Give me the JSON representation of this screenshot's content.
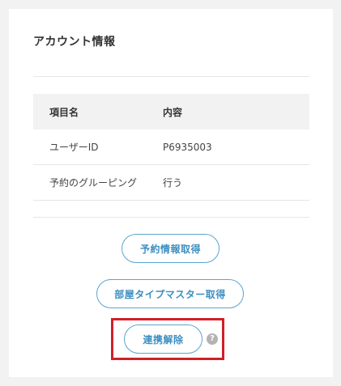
{
  "account_card": {
    "title": "アカウント情報",
    "table": {
      "headers": {
        "name": "項目名",
        "value": "内容"
      },
      "rows": [
        {
          "name": "ユーザーID",
          "value": "P6935003"
        },
        {
          "name": "予約のグルーピング",
          "value": "行う"
        }
      ]
    },
    "buttons": {
      "fetch_reservations": "予約情報取得",
      "fetch_room_type_master": "部屋タイプマスター取得",
      "unlink": "連携解除"
    },
    "help_icon_glyph": "?"
  },
  "colors": {
    "accent": "#3d8fc0",
    "highlight_border": "#d0202a",
    "header_bg": "#f2f2f2"
  },
  "icons": {
    "help": "question-circle-icon"
  }
}
